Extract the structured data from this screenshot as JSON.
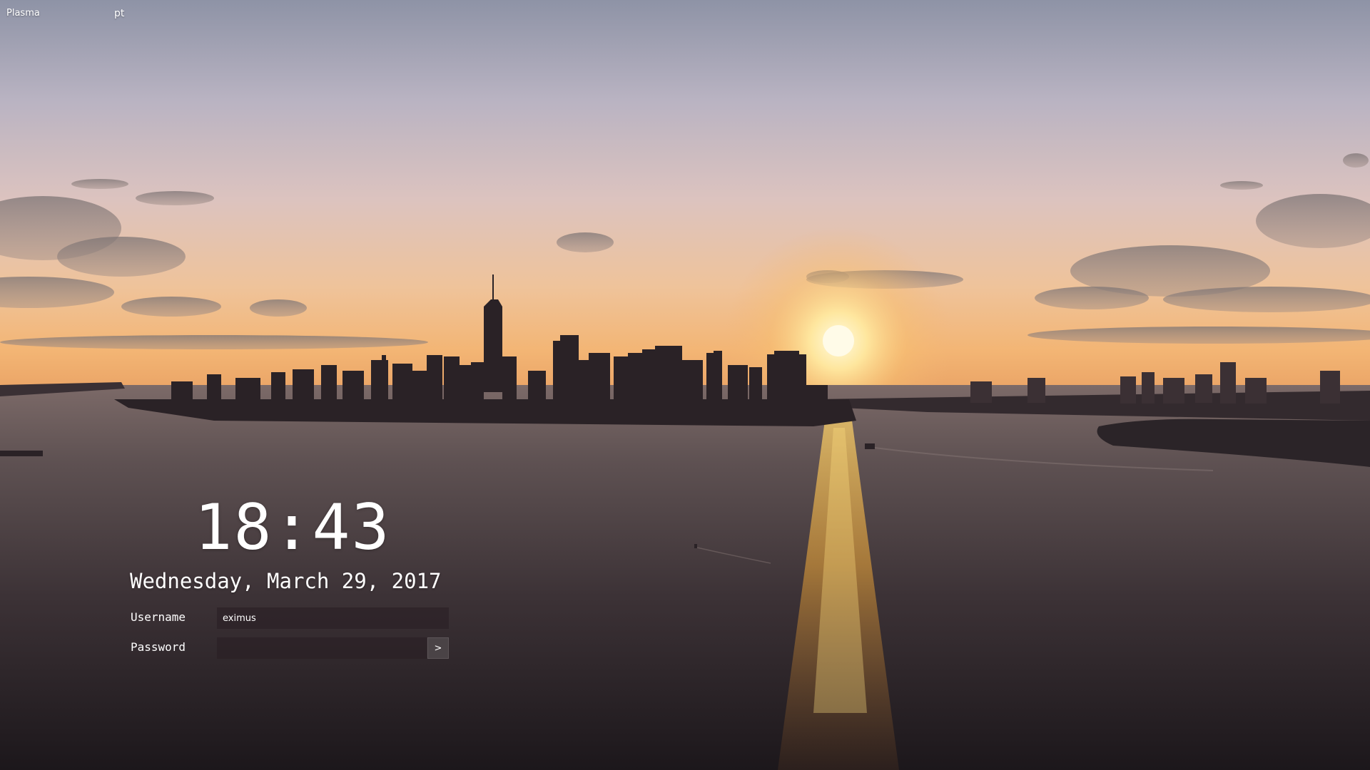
{
  "top_bar": {
    "session": "Plasma",
    "keyboard_layout": "pt"
  },
  "clock": {
    "time": "18:43",
    "date": "Wednesday, March 29, 2017"
  },
  "login_form": {
    "username_label": "Username",
    "username_value": "eximus",
    "password_label": "Password",
    "password_value": "",
    "login_button_label": ">"
  },
  "wallpaper": {
    "icon": "city-skyline-sunset-icon",
    "colors": {
      "sky_top": "#8f94a8",
      "sky_mid": "#c9b3b8",
      "sky_horizon": "#f0b878",
      "sun": "#fff2b0",
      "skyline": "#2a2226",
      "water_top": "#6e5c5c",
      "water_bottom": "#1f1a1e",
      "reflection": "#f2b040"
    }
  }
}
